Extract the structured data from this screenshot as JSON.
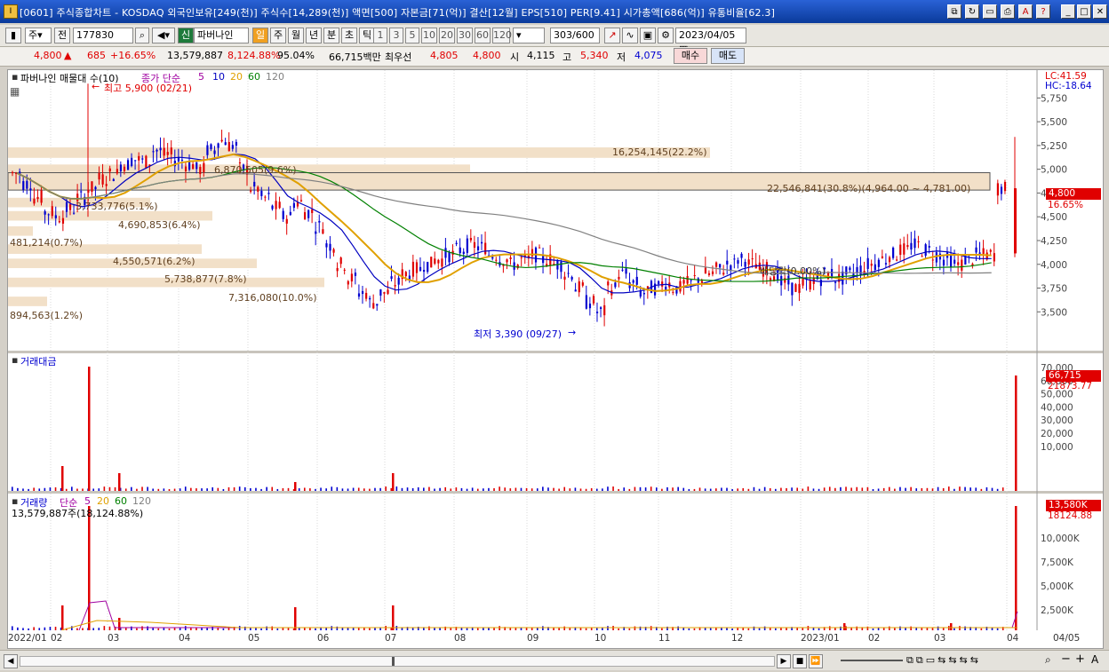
{
  "window": {
    "title": "[0601] 주식종합차트 - KOSDAQ 외국인보유[249(천)] 주식수[14,289(천)] 액면[500] 자본금[71(억)] 결산[12월] EPS[510] PER[9.41] 시가총액[686(억)] 유통비율[62.3]",
    "app_icon": "I"
  },
  "toolbar": {
    "mode": "주",
    "prev_label": "전",
    "code": "177830",
    "stock_name": "파버나인",
    "new_badge": "신",
    "periods": [
      "일",
      "주",
      "월",
      "년",
      "분",
      "초",
      "틱"
    ],
    "active_period": "일",
    "intervals": [
      "1",
      "3",
      "5",
      "10",
      "20",
      "30",
      "60",
      "120"
    ],
    "count": "303",
    "count_total": "/600",
    "date": "2023/04/05"
  },
  "quote": {
    "price": "4,800",
    "change": "685",
    "change_pct": "+16.65%",
    "volume": "13,579,887",
    "vol_ratio": "8,124.88%",
    "strength": "95.04%",
    "amount": "66,715백만",
    "best_label": "최우선",
    "ask": "4,805",
    "bid": "4,800",
    "open_label": "시",
    "open": "4,115",
    "high_label": "고",
    "high": "5,340",
    "low_label": "저",
    "low": "4,075",
    "buy": "매수",
    "sell": "매도"
  },
  "price_panel": {
    "legend_title": "파버나인 매물대 수(10)",
    "legend_ma": "종가 단순",
    "legend_ma_periods": [
      "5",
      "10",
      "20",
      "60",
      "120"
    ],
    "lc": "LC:41.59",
    "hc": "HC:-18.64",
    "y_ticks": [
      "5,750",
      "5,500",
      "5,250",
      "5,000",
      "4,750",
      "4,500",
      "4,250",
      "4,000",
      "3,750",
      "3,500"
    ],
    "current_price_tag": "4,800",
    "current_pct_tag": "16.65%",
    "high_annot": "최고 5,900 (02/21)",
    "low_annot": "최저 3,390 (09/27)",
    "div_annot": "배당락(0.00%)",
    "volume_profile": [
      "16,254,145(22.2%)",
      "22,546,841(30.8%)(4,964.00 ~ 4,781.00)",
      "6,870,505(9.6%)",
      "3,733,776(5.1%)",
      "4,690,853(6.4%)",
      "481,214(0.7%)",
      "4,550,571(6.2%)",
      "5,738,877(7.8%)",
      "7,316,080(10.0%)",
      "894,563(1.2%)"
    ]
  },
  "amount_panel": {
    "legend": "거래대금",
    "y_ticks": [
      "70,000",
      "60,000",
      "50,000",
      "40,000",
      "30,000",
      "20,000",
      "10,000"
    ],
    "tag1": "66,715",
    "tag2": "21873.77"
  },
  "volume_panel": {
    "legend": "거래량",
    "legend_ma": "단순",
    "legend_ma_periods": [
      "5",
      "20",
      "60",
      "120"
    ],
    "sub": "13,579,887주(18,124.88%)",
    "y_ticks": [
      "10,000K",
      "7,500K",
      "5,000K",
      "2,500K"
    ],
    "tag1": "13,580K",
    "tag2": "18124.88"
  },
  "x_axis": [
    "2022/01",
    "02",
    "03",
    "04",
    "05",
    "06",
    "07",
    "08",
    "09",
    "10",
    "11",
    "12",
    "2023/01",
    "02",
    "03",
    "04",
    "04/05"
  ],
  "colors": {
    "up": "#e00000",
    "down": "#0000d0",
    "ma5": "#0000c0",
    "ma20": "#e0a000",
    "ma60": "#008000",
    "ma120": "#808080",
    "profile": "#f2e0c8"
  }
}
